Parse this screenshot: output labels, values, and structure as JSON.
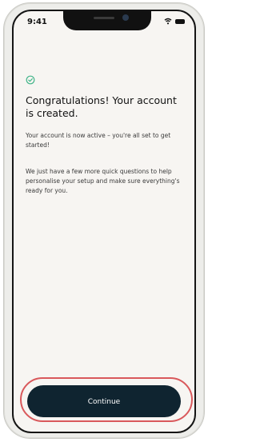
{
  "status_bar": {
    "time": "9:41"
  },
  "confirmation": {
    "icon": "check-circle-icon",
    "title": "Congratulations! Your account is created.",
    "body_1": "Your account is now active – you're all set to get started!",
    "body_2": "We just have a few more quick questions to help personalise your setup and make sure everything's ready for you."
  },
  "actions": {
    "continue_label": "Continue"
  },
  "colors": {
    "accent_check": "#43b58a",
    "button_bg": "#0f2430",
    "highlight_outline": "#d9585b",
    "screen_bg": "#f7f5f2"
  }
}
